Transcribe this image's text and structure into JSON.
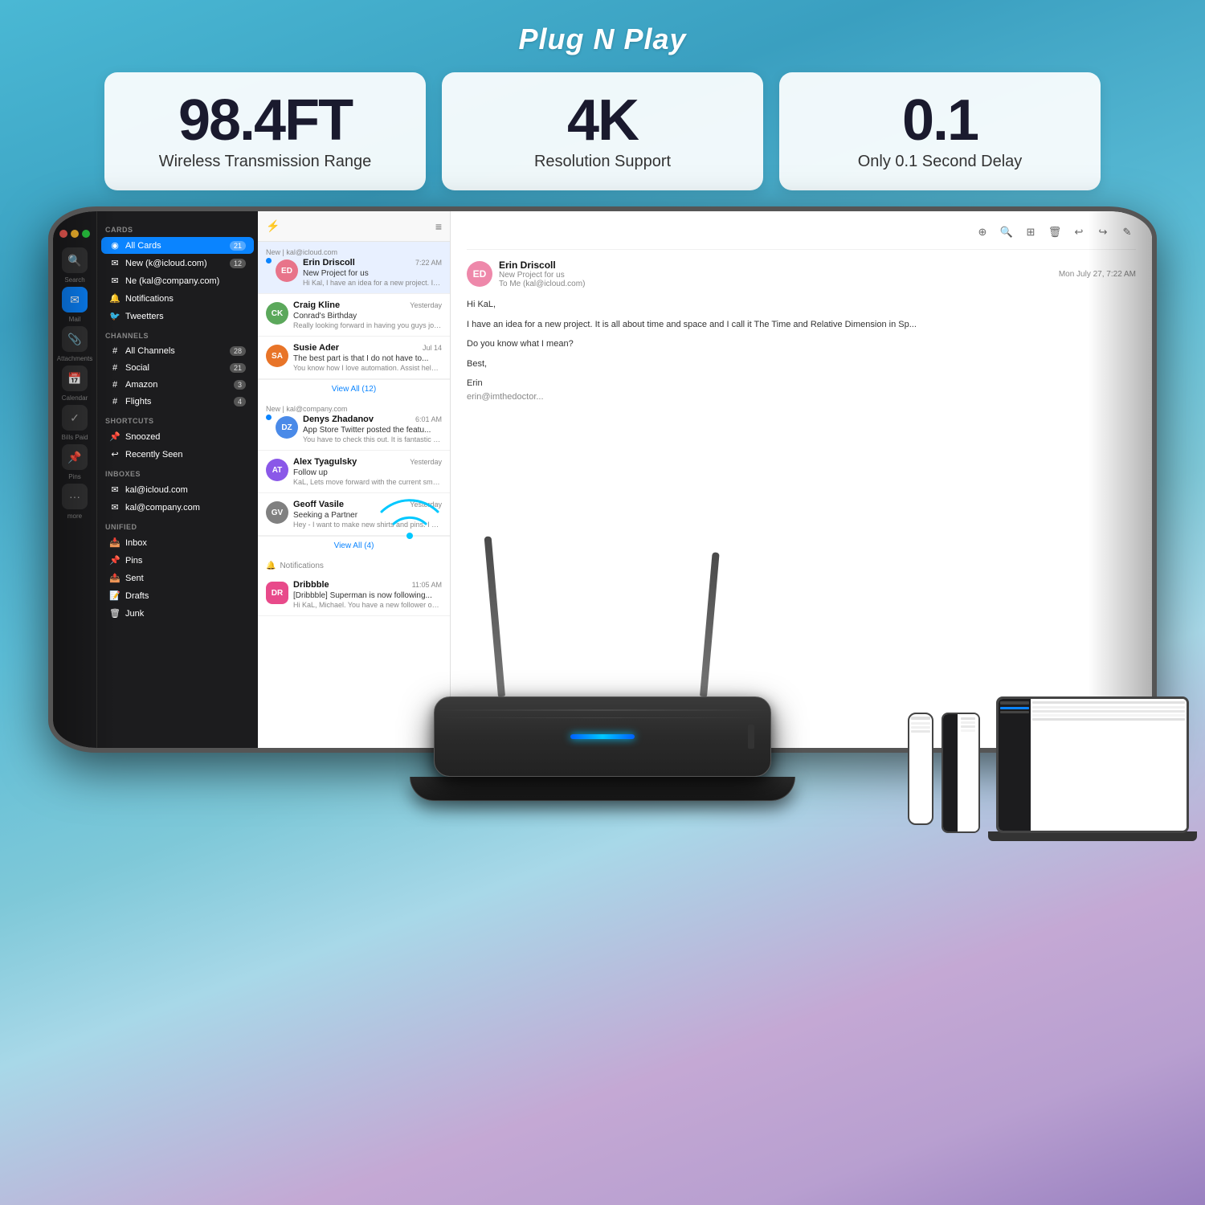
{
  "header": {
    "title": "Plug N Play"
  },
  "specs": [
    {
      "value": "98.4FT",
      "label": "Wireless Transmission Range"
    },
    {
      "value": "4K",
      "label": "Resolution Support"
    },
    {
      "value": "0.1",
      "label": "Only 0.1 Second Delay"
    }
  ],
  "mail_app": {
    "sidebar": {
      "cards_label": "CARDS",
      "all_cards": "All Cards",
      "all_cards_count": "21",
      "items": [
        {
          "label": "New (k@icloud.com)",
          "count": "12",
          "icon": "✉"
        },
        {
          "label": "Ne (kal@company.com)",
          "count": "",
          "icon": "✉"
        },
        {
          "label": "Notifications",
          "count": "",
          "icon": "🔔"
        },
        {
          "label": "Tweetters",
          "count": "",
          "icon": "🐦"
        }
      ],
      "channels_label": "CHANNELS",
      "channels": [
        {
          "label": "All Channels",
          "count": "28",
          "icon": "#"
        },
        {
          "label": "Social",
          "count": "21",
          "icon": "#"
        },
        {
          "label": "Amazon",
          "count": "3",
          "icon": "#"
        },
        {
          "label": "Flights",
          "count": "4",
          "icon": "#"
        }
      ],
      "shortcuts_label": "SHORTCUTS",
      "shortcuts": [
        {
          "label": "Snoozed",
          "icon": "📌"
        },
        {
          "label": "Recently Seen",
          "icon": "↩"
        }
      ],
      "inboxes_label": "INBOXES",
      "inboxes": [
        {
          "label": "kal@icloud.com",
          "icon": "✉"
        },
        {
          "label": "kal@company.com",
          "icon": "✉"
        }
      ],
      "unified_label": "UNIFIED",
      "unified": [
        {
          "label": "Inbox",
          "icon": "📥"
        },
        {
          "label": "Pins",
          "icon": "📌"
        },
        {
          "label": "Sent",
          "icon": "📤"
        },
        {
          "label": "Drafts",
          "icon": "📝"
        },
        {
          "label": "Junk",
          "icon": "🗑"
        }
      ]
    },
    "nav_icons": [
      {
        "icon": "🔍",
        "label": "Search"
      },
      {
        "icon": "✉",
        "label": "Mail",
        "active": true
      },
      {
        "icon": "📎",
        "label": "Attachments"
      },
      {
        "icon": "📅",
        "label": "Calendar"
      },
      {
        "icon": "✓",
        "label": "Bills Paid"
      },
      {
        "icon": "📌",
        "label": "Pins"
      },
      {
        "icon": "•••",
        "label": "more"
      }
    ],
    "messages": [
      {
        "sender": "Erin Driscoll",
        "time": "7:22 AM",
        "subject": "New Project for us",
        "preview": "Hi Kal, I have an idea for a new project. It is all about time and space and I call it The Ta...",
        "avatar_color": "#e8748a",
        "avatar_initials": "ED",
        "selected": true,
        "new_indicator": "New",
        "new_email": "kal@icloud.com"
      },
      {
        "sender": "Craig Kline",
        "time": "Yesterday",
        "subject": "Conrad's Birthday",
        "preview": "Really looking forward in having you guys join us for Conrad first birthday. Everyone here i...",
        "avatar_color": "#5ba85b",
        "avatar_initials": "CK",
        "selected": false
      },
      {
        "sender": "Susie Ader",
        "time": "Jul 14",
        "subject": "The best part is that I do not have to...",
        "preview": "You know how I love automation. Assist helps me with that. I can assist support my sale...",
        "avatar_color": "#e87428",
        "avatar_initials": "SA",
        "selected": false
      },
      {
        "sender": "Denys Zhadanov",
        "time": "6:01 AM",
        "subject": "App Store Twitter posted the featu...",
        "preview": "You have to check this out. It is fantastic Kal. I think the graphic came out really good too....",
        "avatar_color": "#4a8ae8",
        "avatar_initials": "DZ",
        "new_indicator": "New",
        "new_email": "kal@company.com",
        "selected": false
      },
      {
        "sender": "Alex Tyagulsky",
        "time": "Yesterday",
        "subject": "Follow up",
        "preview": "KaL, Lets move forward with the current smart inbox design for iPad. People are lovin...",
        "avatar_color": "#8a58e8",
        "avatar_initials": "AT",
        "selected": false
      },
      {
        "sender": "Geoff Vasile",
        "time": "Yesterday",
        "subject": "Seeking a Partner",
        "preview": "Hey - I want to make new shirts and pins. I also have a great idea for the app we were w...",
        "avatar_color": "#808080",
        "avatar_initials": "GV",
        "selected": false
      }
    ],
    "view_all_12": "View All (12)",
    "view_all_4": "View All (4)",
    "notifications_label": "Notifications",
    "dribbble_notification": {
      "sender": "Dribbble",
      "time": "11:05 AM",
      "subject": "[Dribbble] Superman is now following...",
      "preview": "Hi KaL, Michael. You have a new follower on Dribbble. Superman UX/UI powerhouse and...",
      "avatar_color": "#e84a8a",
      "avatar_initials": "DR"
    },
    "email_detail": {
      "sender_name": "Erin Driscoll",
      "subject": "New Project for us",
      "date": "Mon July 27, 7:22 AM",
      "to": "To Me (kal@icloud.com)",
      "avatar_color": "#e8748a",
      "avatar_initials": "ED",
      "body_lines": [
        "Hi KaL,",
        "",
        "I have an idea for a new project. It is all about time and space and I call it The Time and Relative Dimension in Sp...",
        "",
        "Do you know what I mean?",
        "",
        "Best,",
        "",
        "Erin",
        "erin@imthedoctor..."
      ]
    }
  },
  "device": {
    "led_color": "#00c8ff"
  }
}
